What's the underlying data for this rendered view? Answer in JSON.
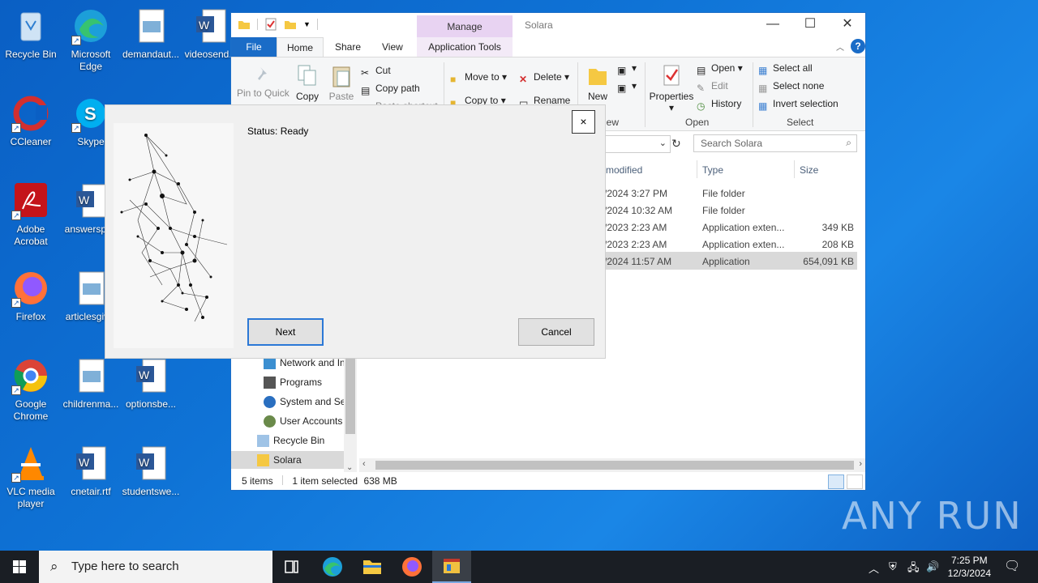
{
  "desktop": {
    "icons": [
      {
        "label": "Recycle Bin"
      },
      {
        "label": "Microsoft Edge"
      },
      {
        "label": "demandaut..."
      },
      {
        "label": "videosend..."
      },
      {
        "label": "CCleaner"
      },
      {
        "label": "Skype"
      },
      {
        "label": "Adobe Acrobat"
      },
      {
        "label": "answerspr..."
      },
      {
        "label": "Firefox"
      },
      {
        "label": "articlesgiv..."
      },
      {
        "label": "Google Chrome"
      },
      {
        "label": "childrenma..."
      },
      {
        "label": "optionsbe..."
      },
      {
        "label": "VLC media player"
      },
      {
        "label": "cnetair.rtf"
      },
      {
        "label": "studentswe..."
      }
    ]
  },
  "explorer": {
    "title": "Solara",
    "manage_label": "Manage",
    "tabs": {
      "file": "File",
      "home": "Home",
      "share": "Share",
      "view": "View",
      "app_tools": "Application Tools"
    },
    "ribbon": {
      "pin": "Pin to Quick",
      "copy": "Copy",
      "paste": "Paste",
      "cut": "Cut",
      "copy_path": "Copy path",
      "paste_shortcut": "Paste shortcut",
      "move_to": "Move to",
      "copy_to": "Copy to",
      "delete": "Delete",
      "rename": "Rename",
      "new_folder": "New folder",
      "new_label": "New",
      "view_partial": "iew",
      "properties": "Properties",
      "open": "Open",
      "edit": "Edit",
      "history": "History",
      "open_group": "Open",
      "select_all": "Select all",
      "select_none": "Select none",
      "invert_selection": "Invert selection",
      "select_group": "Select"
    },
    "search_placeholder": "Search Solara",
    "columns": {
      "modified": "modified",
      "type": "Type",
      "size": "Size"
    },
    "rows": [
      {
        "date": "/2024 3:27 PM",
        "type": "File folder",
        "size": ""
      },
      {
        "date": "/2024 10:32 AM",
        "type": "File folder",
        "size": ""
      },
      {
        "date": "/2023 2:23 AM",
        "type": "Application exten...",
        "size": "349 KB"
      },
      {
        "date": "/2023 2:23 AM",
        "type": "Application exten...",
        "size": "208 KB"
      },
      {
        "date": "/2024 11:57 AM",
        "type": "Application",
        "size": "654,091 KB"
      }
    ],
    "nav": [
      {
        "label": "Network and In"
      },
      {
        "label": "Programs"
      },
      {
        "label": "System and Sec"
      },
      {
        "label": "User Accounts"
      },
      {
        "label": "Recycle Bin"
      },
      {
        "label": "Solara"
      }
    ],
    "status": {
      "items": "5 items",
      "selected": "1 item selected",
      "size": "638 MB"
    }
  },
  "dialog": {
    "status": "Status: Ready",
    "next": "Next",
    "cancel": "Cancel",
    "close": "×"
  },
  "taskbar": {
    "search_placeholder": "Type here to search",
    "time": "7:25 PM",
    "date": "12/3/2024"
  },
  "watermark": "ANY RUN"
}
